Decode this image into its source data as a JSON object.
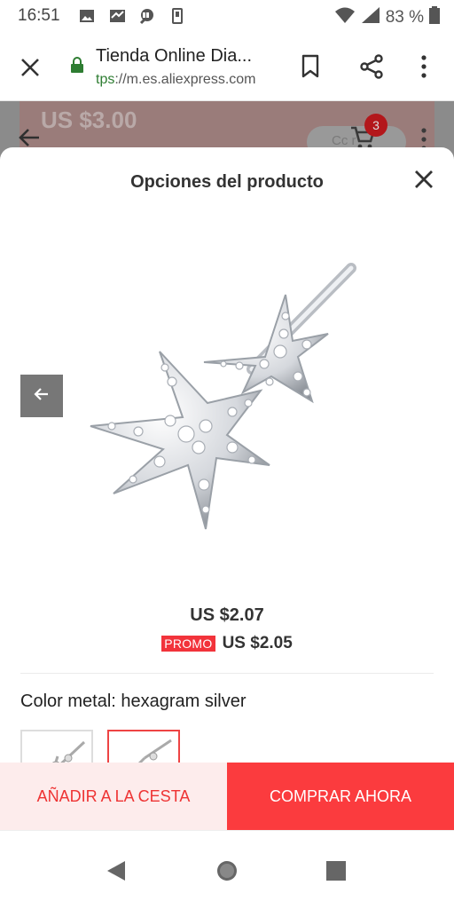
{
  "status_bar": {
    "time": "16:51",
    "battery_percent": "83 %",
    "icons": [
      "image-icon",
      "mail-icon",
      "chat-icon",
      "phone-storage-icon",
      "wifi-icon",
      "signal-icon",
      "battery-icon"
    ]
  },
  "browser": {
    "title": "Tienda Online Dia...",
    "url_scheme": "tps",
    "url_rest": "://m.es.aliexpress.com"
  },
  "background_page": {
    "price": "US $3.00",
    "button_label": "Cc    r",
    "cart_count": "3"
  },
  "sheet": {
    "title": "Opciones del producto",
    "price": "US $2.07",
    "promo_badge": "PROMO",
    "promo_price": "US $2.05",
    "option_label": "Color metal: hexagram silver",
    "thumbnails_count": 2,
    "selected_thumbnail": 2
  },
  "actions": {
    "add_to_cart": "AÑADIR A LA CESTA",
    "buy_now": "COMPRAR AHORA"
  },
  "colors": {
    "accent": "#fb3b3e",
    "accent_light": "#fdecec",
    "promo": "#f2333b",
    "secure": "#2e7d32"
  }
}
